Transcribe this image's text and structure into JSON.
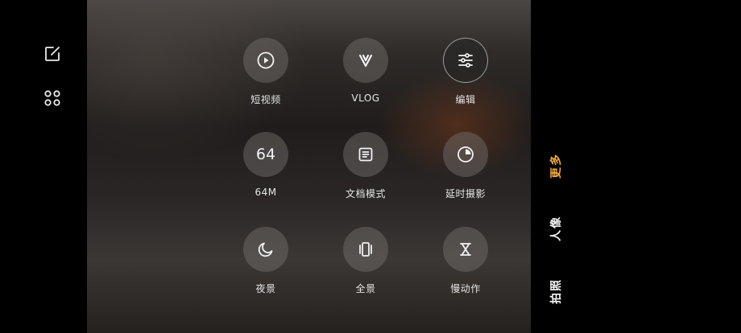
{
  "left_toolbar": {
    "edit_icon": "edit-square-icon",
    "apps_icon": "grid-dots-icon"
  },
  "modes": [
    {
      "label": "短视频",
      "icon": "play-circle-icon"
    },
    {
      "label": "VLOG",
      "icon": "vlog-v-icon"
    },
    {
      "label": "编辑",
      "icon": "sliders-icon",
      "selected": true
    },
    {
      "label": "64M",
      "icon_text": "64"
    },
    {
      "label": "文档模式",
      "icon": "document-icon"
    },
    {
      "label": "延时摄影",
      "icon": "timelapse-pie-icon"
    },
    {
      "label": "夜景",
      "icon": "moon-icon"
    },
    {
      "label": "全景",
      "icon": "panorama-icon"
    },
    {
      "label": "慢动作",
      "icon": "hourglass-icon"
    }
  ],
  "tabs": [
    {
      "label": "更多",
      "active": true
    },
    {
      "label": "人像",
      "active": false
    },
    {
      "label": "拍照",
      "active": false
    }
  ],
  "colors": {
    "active_tab": "#f2a93b",
    "label": "#e6e6e6",
    "background": "#000000"
  }
}
